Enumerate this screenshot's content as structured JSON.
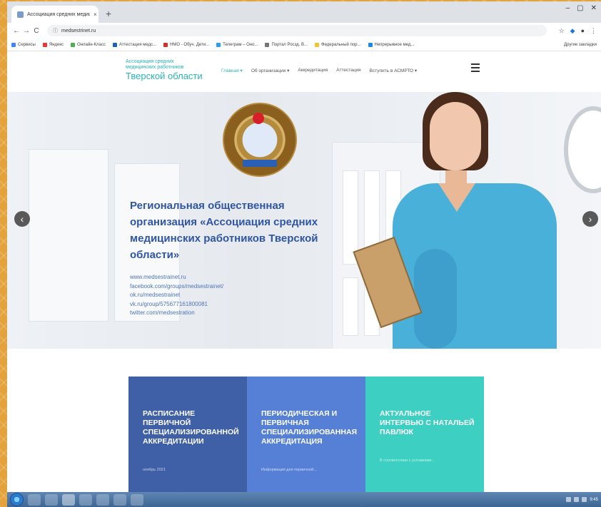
{
  "browser": {
    "tab_title": "Ассоциация средних медицинских...",
    "tab_close": "×",
    "new_tab": "+",
    "window_controls": [
      "–",
      "▢",
      "✕"
    ],
    "nav": {
      "back": "←",
      "forward": "→",
      "reload": "C",
      "home": "⌂"
    },
    "url": "medsestrinet.ru",
    "bookmarks": [
      {
        "label": "Сервисы",
        "color": "#4285f4"
      },
      {
        "label": "Яндекс",
        "color": "#e53935"
      },
      {
        "label": "Онлайн-Класс",
        "color": "#4caf50"
      },
      {
        "label": "Аттестация медс...",
        "color": "#1565c0"
      },
      {
        "label": "НМО - Обуч. Дети...",
        "color": "#d32f2f"
      },
      {
        "label": "Телеграм – Оно...",
        "color": "#2a9df4"
      },
      {
        "label": "Портал Росзд. В...",
        "color": "#757575"
      },
      {
        "label": "Федеральный пор...",
        "color": "#fbc02d"
      },
      {
        "label": "Непрерывное мед...",
        "color": "#1e88e5"
      }
    ],
    "bookmarks_other": "Другие закладки"
  },
  "site": {
    "logo": {
      "line1": "Ассоциация средних",
      "line2": "медицинских работников",
      "line3": "Тверской области"
    },
    "nav": [
      {
        "label": "Главная ▾"
      },
      {
        "label": "Об организации ▾"
      },
      {
        "label": "Аккредитация"
      },
      {
        "label": "Аттестация"
      },
      {
        "label": "Вступить в АСМРТО ▾"
      }
    ],
    "hero": {
      "title": "Региональная общественная организация «Ассоциация средних медицинских работников Тверской области»",
      "links": [
        "www.medsestrainet.ru",
        "facebook.com/groups/medsestrainet/",
        "ok.ru/medsestrainet",
        "vk.ru/group/575677161800081",
        "twitter.com/medsestration"
      ],
      "prev": "‹",
      "next": "›"
    },
    "cards": [
      {
        "title": "РАСПИСАНИЕ ПЕРВИЧНОЙ СПЕЦИАЛИЗИРОВАННОЙ АККРЕДИТАЦИИ",
        "sub": "ноябрь 2021",
        "color": "#3f5fa6"
      },
      {
        "title": "ПЕРИОДИЧЕСКАЯ и ПЕРВИЧНАЯ СПЕЦИАЛИЗИРОВАННАЯ АККРЕДИТАЦИЯ",
        "sub": "Информация для первичной...",
        "color": "#5680d6"
      },
      {
        "title": "АКТУАЛЬНОЕ ИНТЕРВЬЮ С НАТАЛЬЕЙ ПАВЛЮК",
        "sub": "В соответствии с условиями...",
        "color": "#3ccfc2"
      }
    ]
  },
  "taskbar": {
    "time": "9:45"
  }
}
